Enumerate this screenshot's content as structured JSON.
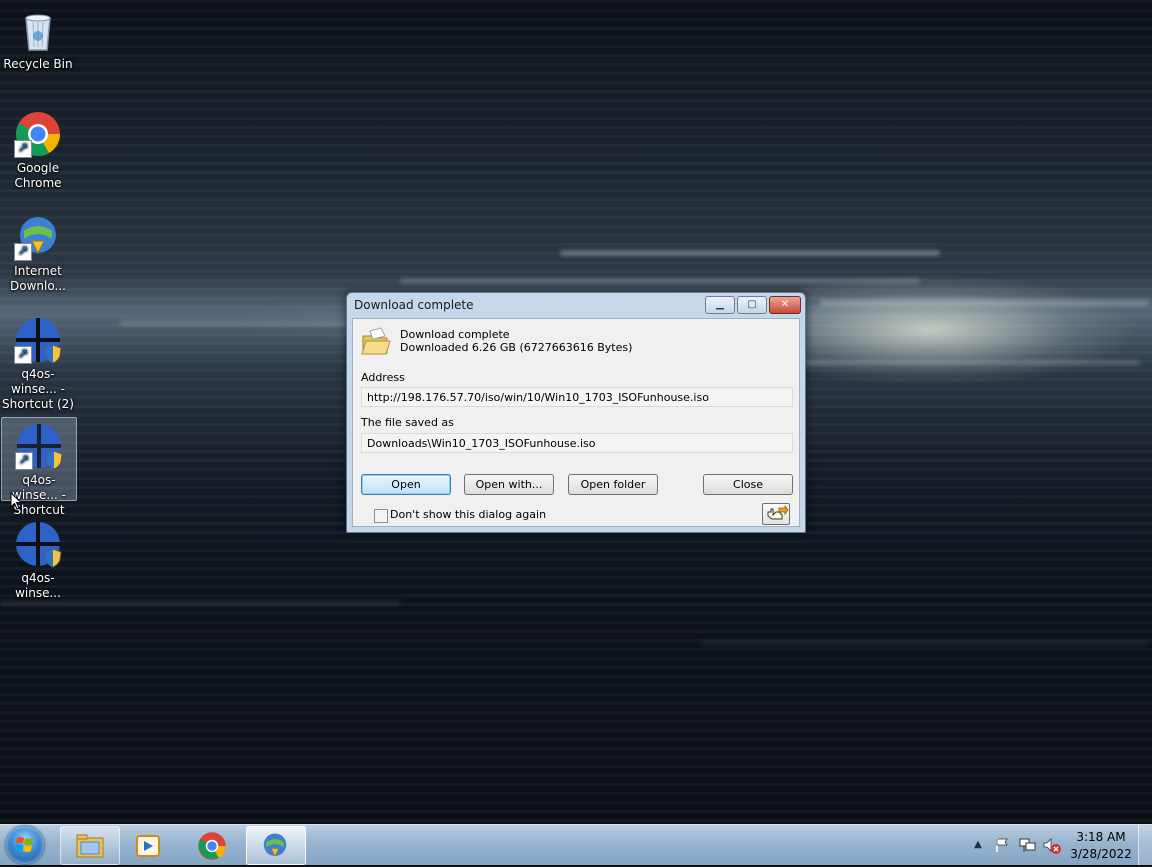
{
  "desktop": {
    "icons": [
      {
        "name": "Recycle Bin",
        "icon": "recycle-bin-icon"
      },
      {
        "name": "Google Chrome",
        "icon": "chrome-icon"
      },
      {
        "name": "Internet Downlo...",
        "icon": "idm-icon"
      },
      {
        "name": "q4os-winse... - Shortcut (2)",
        "icon": "q4os-icon"
      },
      {
        "name": "q4os-winse... - Shortcut",
        "icon": "q4os-icon"
      },
      {
        "name": "q4os-winse...",
        "icon": "q4os-icon"
      }
    ]
  },
  "dialog": {
    "title": "Download complete",
    "message_line1": "Download complete",
    "message_line2": "Downloaded 6.26  GB (6727663616 Bytes)",
    "address_label": "Address",
    "address_value": "http://198.176.57.70/iso/win/10/Win10_1703_ISOFunhouse.iso",
    "saved_label": "The file saved as",
    "saved_value": "Downloads\\Win10_1703_ISOFunhouse.iso",
    "buttons": {
      "open": "Open",
      "open_with": "Open with...",
      "open_folder": "Open folder",
      "close": "Close"
    },
    "dont_show_label": "Don't show this dialog again",
    "dont_show_checked": false
  },
  "taskbar": {
    "pinned": [
      "file-explorer-icon",
      "media-player-icon",
      "chrome-icon",
      "idm-icon"
    ],
    "clock": {
      "time": "3:18 AM",
      "date": "3/28/2022"
    },
    "tray_icons": [
      "show-hidden-icons-arrow",
      "action-center-flag-icon",
      "network-icon",
      "volume-muted-icon"
    ]
  }
}
